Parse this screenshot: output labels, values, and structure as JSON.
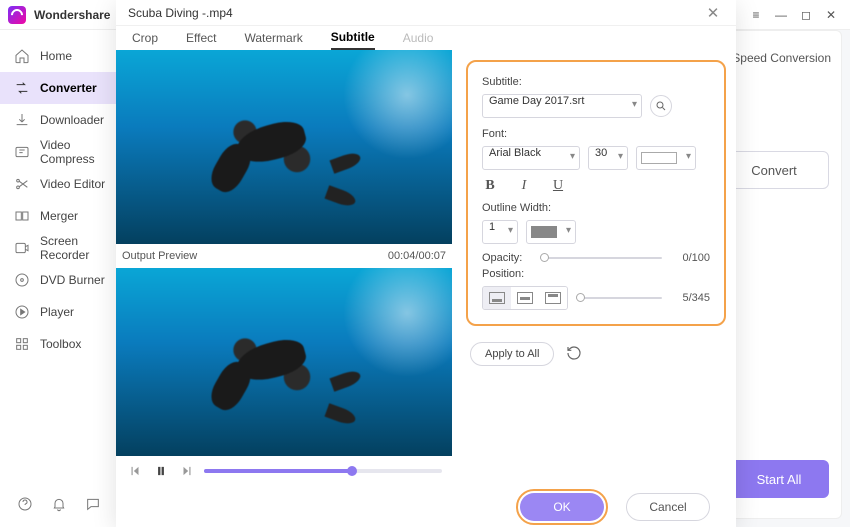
{
  "app": {
    "title": "Wondershare"
  },
  "win": {
    "min": "—",
    "max": "◻",
    "close": "✕",
    "menu": "≡"
  },
  "sidebar": {
    "items": [
      {
        "label": "Home"
      },
      {
        "label": "Converter"
      },
      {
        "label": "Downloader"
      },
      {
        "label": "Video Compress"
      },
      {
        "label": "Video Editor"
      },
      {
        "label": "Merger"
      },
      {
        "label": "Screen Recorder"
      },
      {
        "label": "DVD Burner"
      },
      {
        "label": "Player"
      },
      {
        "label": "Toolbox"
      }
    ]
  },
  "right": {
    "speed": "Speed Conversion",
    "convert": "Convert",
    "startall": "Start All"
  },
  "dialog": {
    "title": "Scuba Diving -.mp4",
    "tabs": {
      "crop": "Crop",
      "effect": "Effect",
      "watermark": "Watermark",
      "subtitle": "Subtitle",
      "audio": "Audio"
    },
    "output_label": "Output Preview",
    "timecode": "00:04/00:07",
    "subtitle": {
      "label": "Subtitle:",
      "file": "Game Day 2017.srt",
      "font_label": "Font:",
      "font": "Arial Black",
      "size": "30",
      "outline_label": "Outline Width:",
      "outline": "1",
      "opacity_label": "Opacity:",
      "opacity_value": "0/100",
      "position_label": "Position:",
      "position_value": "5/345"
    },
    "apply": "Apply to All",
    "ok": "OK",
    "cancel": "Cancel"
  }
}
